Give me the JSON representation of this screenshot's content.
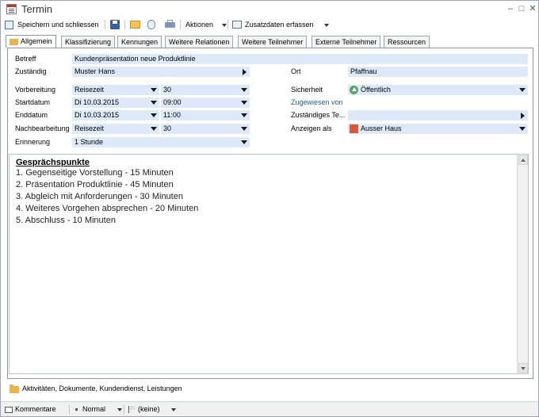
{
  "window": {
    "title": "Termin"
  },
  "toolbar": {
    "save_close_label": "Speichern und schliessen",
    "actions_label": "Aktionen",
    "extra_data_label": "Zusatzdaten erfassen"
  },
  "tabs": [
    {
      "label": "Allgemein",
      "active": true
    },
    {
      "label": "Klassifizierung"
    },
    {
      "label": "Kennungen"
    },
    {
      "label": "Weitere Relationen"
    },
    {
      "label": "Weitere Teilnehmer"
    },
    {
      "label": "Externe Teilnehmer"
    },
    {
      "label": "Ressourcen"
    }
  ],
  "form": {
    "betreff_label": "Betreff",
    "betreff_value": "Kundenpräsentation neue Produktlinie",
    "zustaendig_label": "Zuständig",
    "zustaendig_value": "Muster Hans",
    "ort_label": "Ort",
    "ort_value": "Pfaffnau",
    "vorbereitung_label": "Vorbereitung",
    "vorbereitung_type": "Reisezeit",
    "vorbereitung_minutes": "30",
    "startdatum_label": "Startdatum",
    "start_date": "Di 10.03.2015",
    "start_time": "09:00",
    "enddatum_label": "Enddatum",
    "end_date": "Di 10.03.2015",
    "end_time": "11:00",
    "nachbearbeitung_label": "Nachbearbeitung",
    "nachbearbeitung_type": "Reisezeit",
    "nachbearbeitung_minutes": "30",
    "erinnerung_label": "Erinnerung",
    "erinnerung_value": "1 Stunde",
    "sicherheit_label": "Sicherheit",
    "sicherheit_value": "Öffentlich",
    "zugewiesen_label": "Zugewiesen von",
    "zustaendiges_team_label": "Zuständiges Te...",
    "anzeigen_label": "Anzeigen als",
    "anzeigen_value": "Ausser Haus",
    "anzeigen_color": "#d9573a"
  },
  "notes": {
    "heading": "Gesprächspunkte",
    "lines": [
      "1. Gegenseitige Vorstellung - 15 Minuten",
      "2. Präsentation Produktlinie - 45 Minuten",
      "3. Abgleich mit Anforderungen - 30 Minuten",
      "4. Weiteres Vorgehen absprechen - 20 Minuten",
      "5. Abschluss - 10 Minuten"
    ]
  },
  "related": {
    "label": "Aktivitäten, Dokumente, Kundendienst, Leistungen"
  },
  "statusbar": {
    "comments_label": "Kommentare",
    "priority_label": "Normal",
    "flag_label": "(keine)"
  },
  "colors": {
    "field_bg": "#dde9f9",
    "border": "#8a96a8",
    "label_blue": "#1f5fa8"
  }
}
